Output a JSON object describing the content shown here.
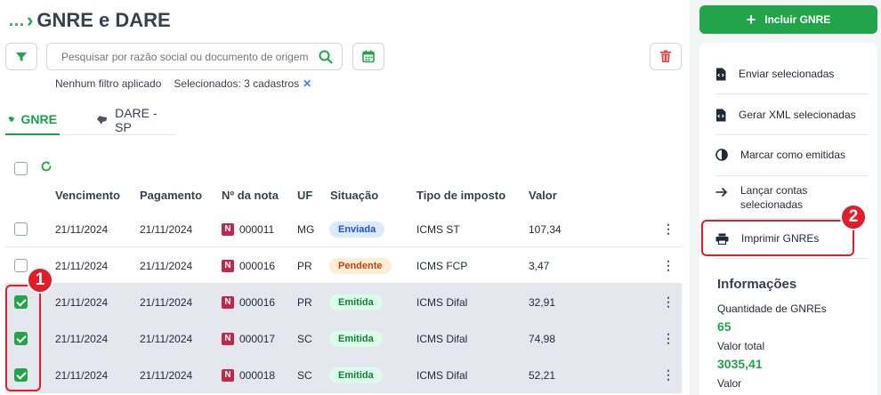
{
  "header": {
    "breadcrumb_dots": "...",
    "title": "GNRE e DARE",
    "include_button_label": "Incluir GNRE"
  },
  "search": {
    "placeholder": "Pesquisar por razão social ou documento de origem"
  },
  "filters": {
    "status_text": "Nenhum filtro aplicado",
    "selected_text": "Selecionados: 3 cadastros"
  },
  "tabs": [
    {
      "label": "GNRE",
      "active": true
    },
    {
      "label": "DARE - SP",
      "active": false
    }
  ],
  "table": {
    "columns": [
      "Vencimento",
      "Pagamento",
      "Nº da nota",
      "UF",
      "Situação",
      "Tipo de imposto",
      "Valor"
    ],
    "rows": [
      {
        "vencimento": "21/11/2024",
        "pagamento": "21/11/2024",
        "nota": "000011",
        "uf": "MG",
        "situacao": "Enviada",
        "tipo": "ICMS ST",
        "valor": "107,34",
        "checked": false
      },
      {
        "vencimento": "21/11/2024",
        "pagamento": "21/11/2024",
        "nota": "000016",
        "uf": "PR",
        "situacao": "Pendente",
        "tipo": "ICMS FCP",
        "valor": "3,47",
        "checked": false
      },
      {
        "vencimento": "21/11/2024",
        "pagamento": "21/11/2024",
        "nota": "000016",
        "uf": "PR",
        "situacao": "Emitida",
        "tipo": "ICMS Difal",
        "valor": "32,91",
        "checked": true
      },
      {
        "vencimento": "21/11/2024",
        "pagamento": "21/11/2024",
        "nota": "000017",
        "uf": "SC",
        "situacao": "Emitida",
        "tipo": "ICMS Difal",
        "valor": "74,98",
        "checked": true
      },
      {
        "vencimento": "21/11/2024",
        "pagamento": "21/11/2024",
        "nota": "000018",
        "uf": "SC",
        "situacao": "Emitida",
        "tipo": "ICMS Difal",
        "valor": "52,21",
        "checked": true
      }
    ],
    "n_badge": "N"
  },
  "actions_menu": {
    "items": [
      {
        "label": "Enviar selecionadas",
        "icon": "file-code-icon"
      },
      {
        "label": "Gerar XML selecionadas",
        "icon": "file-code-icon"
      },
      {
        "label": "Marcar como emitidas",
        "icon": "half-circle-icon"
      },
      {
        "label": "Lançar contas selecionadas",
        "icon": "arrow-right-icon"
      },
      {
        "label": "Imprimir GNREs",
        "icon": "printer-icon"
      }
    ]
  },
  "info": {
    "title": "Informações",
    "quantity_label": "Quantidade de GNREs",
    "quantity_value": "65",
    "total_label": "Valor total",
    "total_value": "3035,41",
    "valor_label": "Valor"
  },
  "annotations": [
    "1",
    "2"
  ],
  "colors": {
    "brand_green": "#22a54a",
    "enviada_bg": "#dbeafe",
    "enviada_fg": "#1d4ed8",
    "pendente_bg": "#ffedd5",
    "pendente_fg": "#c2410c",
    "emitida_bg": "#dcfce7",
    "emitida_fg": "#15803d",
    "annotation_red": "#e11d2a"
  }
}
